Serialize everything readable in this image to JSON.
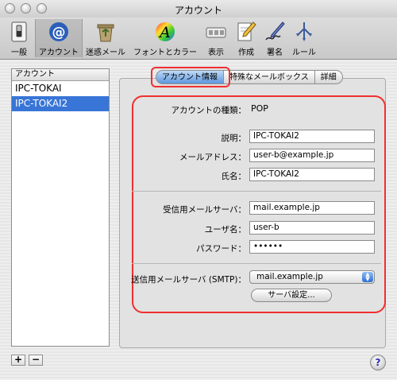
{
  "window": {
    "title": "アカウント"
  },
  "toolbar": {
    "items": [
      {
        "label": "一般",
        "icon": "switch-icon"
      },
      {
        "label": "アカウント",
        "icon": "at-sign-icon"
      },
      {
        "label": "迷惑メール",
        "icon": "recycle-icon"
      },
      {
        "label": "フォントとカラー",
        "icon": "font-color-icon"
      },
      {
        "label": "表示",
        "icon": "display-icon"
      },
      {
        "label": "作成",
        "icon": "compose-icon"
      },
      {
        "label": "署名",
        "icon": "signature-icon"
      },
      {
        "label": "ルール",
        "icon": "rules-icon"
      }
    ],
    "selected": "アカウント"
  },
  "accounts": {
    "header": "アカウント",
    "items": [
      {
        "name": "IPC-TOKAI",
        "selected": false
      },
      {
        "name": "IPC-TOKAI2",
        "selected": true
      }
    ],
    "add_label": "+",
    "remove_label": "−"
  },
  "tabs": [
    {
      "label": "アカウント情報",
      "active": true
    },
    {
      "label": "特殊なメールボックス",
      "active": false
    },
    {
      "label": "詳細",
      "active": false
    }
  ],
  "form": {
    "account_type_label": "アカウントの種類：",
    "account_type_value": "POP",
    "description_label": "説明：",
    "description_value": "IPC-TOKAI2",
    "email_label": "メールアドレス：",
    "email_value": "user-b@example.jp",
    "fullname_label": "氏名：",
    "fullname_value": "IPC-TOKAI2",
    "incoming_label": "受信用メールサーバ：",
    "incoming_value": "mail.example.jp",
    "username_label": "ユーザ名：",
    "username_value": "user-b",
    "password_label": "パスワード：",
    "password_value": "••••••",
    "smtp_label": "送信用メールサーバ (SMTP)：",
    "smtp_value": "mail.example.jp",
    "server_settings_button": "サーバ設定..."
  },
  "help_label": "?",
  "colors": {
    "highlight": "#f03030",
    "selection": "#3875d7"
  }
}
